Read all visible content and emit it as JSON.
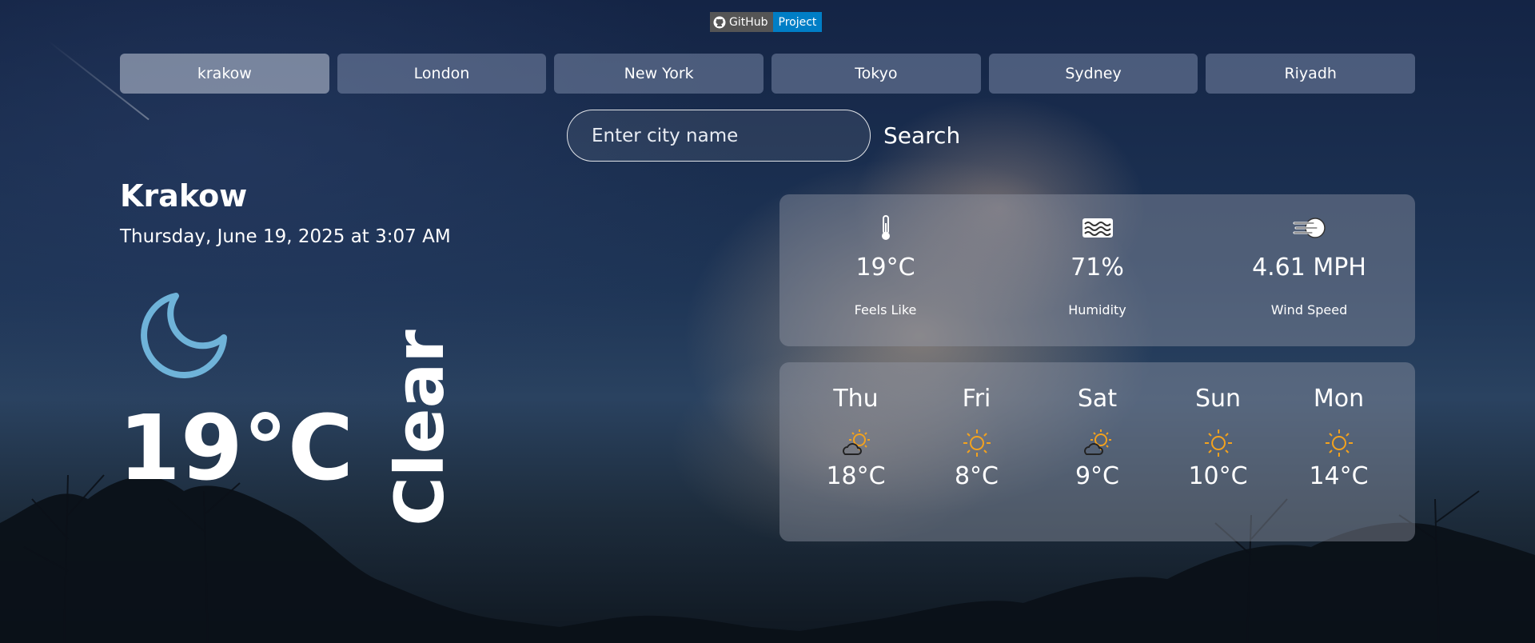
{
  "badge": {
    "left": "GitHub",
    "right": "Project"
  },
  "tabs": [
    "krakow",
    "London",
    "New York",
    "Tokyo",
    "Sydney",
    "Riyadh"
  ],
  "search": {
    "placeholder": "Enter city name",
    "button_label": "Search"
  },
  "current": {
    "city": "Krakow",
    "date": "Thursday, June 19, 2025 at 3:07 AM",
    "icon": "moon-icon",
    "temperature": "19°C",
    "condition": "Clear"
  },
  "stats": [
    {
      "icon": "thermometer-icon",
      "value": "19°C",
      "label": "Feels Like"
    },
    {
      "icon": "humidity-waves-icon",
      "value": "71%",
      "label": "Humidity"
    },
    {
      "icon": "wind-icon",
      "value": "4.61 MPH",
      "label": "Wind Speed"
    }
  ],
  "forecast": [
    {
      "day": "Thu",
      "icon": "partly-cloudy-icon",
      "temp": "18°C"
    },
    {
      "day": "Fri",
      "icon": "sun-icon",
      "temp": "8°C"
    },
    {
      "day": "Sat",
      "icon": "partly-cloudy-icon",
      "temp": "9°C"
    },
    {
      "day": "Sun",
      "icon": "sun-icon",
      "temp": "10°C"
    },
    {
      "day": "Mon",
      "icon": "sun-icon",
      "temp": "14°C"
    }
  ],
  "colors": {
    "moon": "#6fb3d9",
    "sun": "#f3a21e",
    "badge_right": "#007ec6",
    "badge_left": "#555555"
  }
}
